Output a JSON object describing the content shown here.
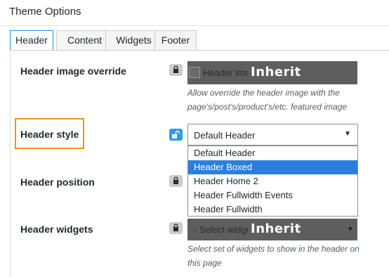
{
  "panel": {
    "title": "Theme Options"
  },
  "tabs": [
    {
      "label": "Header",
      "active": true
    },
    {
      "label": "Content",
      "active": false
    },
    {
      "label": "Widgets",
      "active": false
    },
    {
      "label": "Footer",
      "active": false
    }
  ],
  "rows": {
    "header_image_override": {
      "label": "Header image override",
      "lock": "locked",
      "checkbox_label": "Header image override",
      "inherit_label": "Inherit",
      "description": "Allow override the header image with the page's/post's/product's/etc. featured image"
    },
    "header_style": {
      "label": "Header style",
      "lock": "unlocked",
      "selected": "Default Header",
      "options": [
        {
          "label": "Default Header",
          "highlighted": false
        },
        {
          "label": "Header Boxed",
          "highlighted": true
        },
        {
          "label": "Header Home 2",
          "highlighted": false
        },
        {
          "label": "Header Fullwidth Events",
          "highlighted": false
        },
        {
          "label": "Header Fullwidth",
          "highlighted": false
        }
      ]
    },
    "header_position": {
      "label": "Header position",
      "lock": "locked"
    },
    "header_widgets": {
      "label": "Header widgets",
      "lock": "locked",
      "select_placeholder": "- Select widgets -",
      "inherit_label": "Inherit",
      "description": "Select set of widgets to show in the header on this page"
    }
  },
  "colors": {
    "accent": "#2b9fe0",
    "highlight_border": "#f0931e",
    "inherit_overlay": "#5e5e5e",
    "selected_option": "#2b7ee0"
  },
  "icons": {
    "locked": "lock-icon",
    "unlocked": "unlock-icon",
    "dropdown": "chevron-down-icon"
  }
}
